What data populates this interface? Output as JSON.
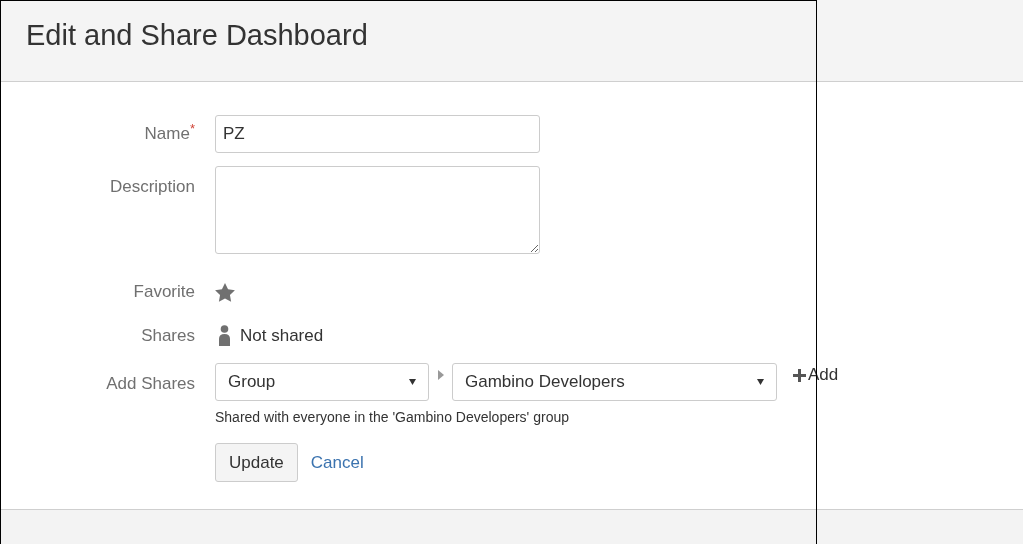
{
  "header": {
    "title": "Edit and Share Dashboard"
  },
  "name": {
    "label": "Name",
    "required_mark": "*",
    "value": "PZ"
  },
  "description": {
    "label": "Description"
  },
  "favorite": {
    "label": "Favorite",
    "on": false
  },
  "shares": {
    "label": "Shares",
    "text": "Not shared"
  },
  "add_shares": {
    "label": "Add Shares",
    "type_select": "Group",
    "group_select": "Gambino Developers",
    "add": "Add",
    "help": "Shared with everyone in the 'Gambino Developers' group"
  },
  "buttons": {
    "update": "Update",
    "cancel": "Cancel"
  }
}
